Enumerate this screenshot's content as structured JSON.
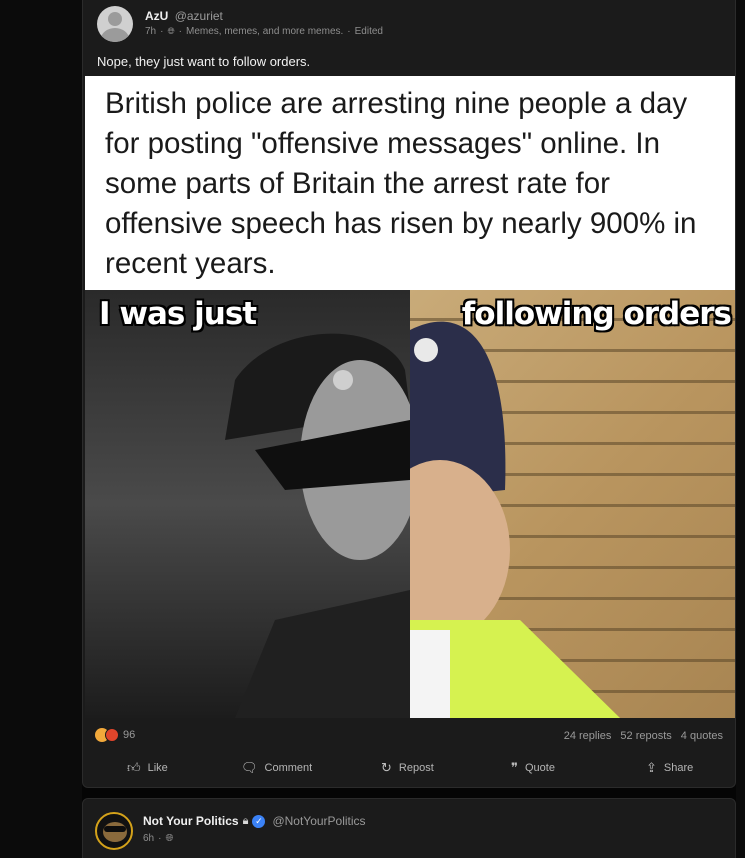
{
  "post": {
    "display_name": "AzU",
    "handle": "@azuriet",
    "time": "7h",
    "separator": "·",
    "visibility_icon": "globe-icon",
    "community": "Memes, memes, and more memes.",
    "edited": "Edited",
    "text": "Nope, they just want to follow orders.",
    "meme": {
      "caption": "British police are arresting nine people a day for posting \"offensive messages\" online. In some parts of Britain the arrest rate for offensive speech has risen by nearly 900% in recent years.",
      "left_text": "I was just",
      "right_text": "following orders"
    },
    "reactions": {
      "count": "96",
      "icons": [
        "thumbs-up-icon",
        "angry-face-icon"
      ]
    },
    "counts": {
      "replies": "24 replies",
      "reposts": "52 reposts",
      "quotes": "4 quotes"
    },
    "actions": {
      "like": "Like",
      "comment": "Comment",
      "repost": "Repost",
      "quote": "Quote",
      "share": "Share"
    }
  },
  "post2": {
    "display_name": "Not Your Politics",
    "handle": "@NotYourPolitics",
    "time": "6h",
    "separator": "·",
    "icons": [
      "lock-icon",
      "verified-icon",
      "globe-icon"
    ]
  },
  "colors": {
    "background": "#050505",
    "card": "#1b1b1b",
    "verified": "#3b82f6",
    "avatar_ring": "#d4a21a"
  }
}
